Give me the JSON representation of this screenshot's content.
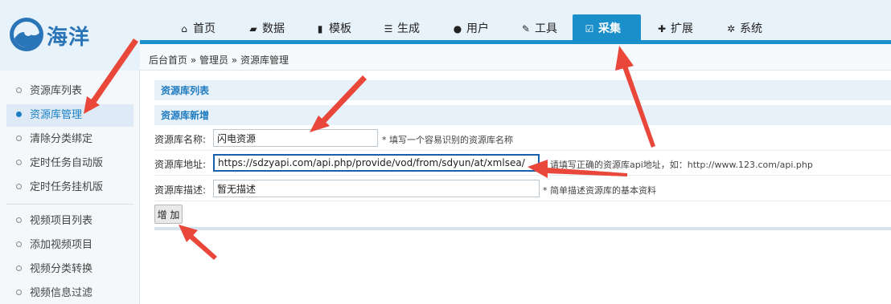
{
  "brand": {
    "logo_text": "海洋",
    "accent": "#1b8fc9"
  },
  "nav": {
    "items": [
      {
        "label": "首页",
        "icon": "home-icon"
      },
      {
        "label": "数据",
        "icon": "book-icon"
      },
      {
        "label": "模板",
        "icon": "file-icon"
      },
      {
        "label": "生成",
        "icon": "server-icon"
      },
      {
        "label": "用户",
        "icon": "user-icon"
      },
      {
        "label": "工具",
        "icon": "wrench-icon"
      },
      {
        "label": "采集",
        "icon": "edit-icon",
        "active": true
      },
      {
        "label": "扩展",
        "icon": "puzzle-icon"
      },
      {
        "label": "系统",
        "icon": "gear-icon"
      }
    ]
  },
  "breadcrumb": {
    "text": "后台首页 » 管理员 » 资源库管理"
  },
  "sidebar": {
    "group1": [
      "资源库列表",
      "资源库管理",
      "清除分类绑定",
      "定时任务自动版",
      "定时任务挂机版"
    ],
    "group2": [
      "视频项目列表",
      "添加视频项目",
      "视频分类转换",
      "视频信息过滤"
    ],
    "active": "资源库管理"
  },
  "main": {
    "list_title": "资源库列表",
    "add_title": "资源库新增",
    "fields": [
      {
        "label": "资源库名称:",
        "value": "闪电资源",
        "hint": "* 填写一个容易识别的资源库名称"
      },
      {
        "label": "资源库地址:",
        "value": "https://sdzyapi.com/api.php/provide/vod/from/sdyun/at/xmlsea/",
        "hint": "* 请填写正确的资源库api地址，如：http://www.123.com/api.php"
      },
      {
        "label": "资源库描述:",
        "value": "暂无描述",
        "hint": "* 简单描述资源库的基本资料"
      }
    ],
    "submit_label": "增 加"
  },
  "annotation_color": "#e8473a"
}
